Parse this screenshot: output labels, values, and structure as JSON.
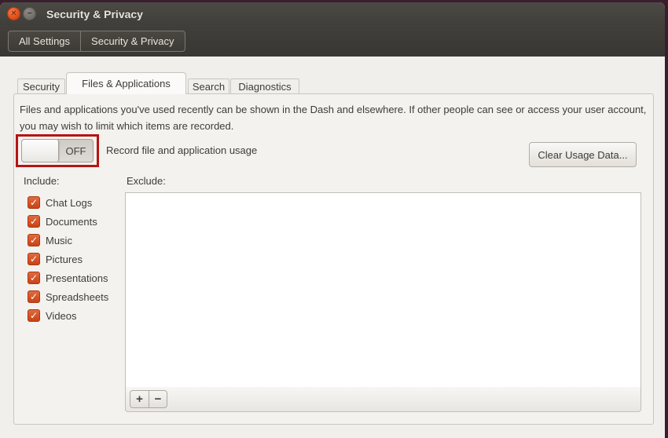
{
  "window": {
    "title": "Security & Privacy"
  },
  "titlebar": {
    "close_icon": "✕",
    "minimize_icon": "−"
  },
  "breadcrumb": {
    "items": [
      {
        "label": "All Settings"
      },
      {
        "label": "Security & Privacy"
      }
    ]
  },
  "tabs": [
    {
      "label": "Security",
      "active": false
    },
    {
      "label": "Files & Applications",
      "active": true
    },
    {
      "label": "Search",
      "active": false
    },
    {
      "label": "Diagnostics",
      "active": false
    }
  ],
  "files_applications": {
    "description": "Files and applications you've used recently can be shown in the Dash and elsewhere. If other people can see or access your user account, you may wish to limit which items are recorded.",
    "record_switch": {
      "state": "OFF",
      "label": "Record file and application usage",
      "annotated": true
    },
    "clear_button_label": "Clear Usage Data...",
    "include": {
      "label": "Include:",
      "items": [
        {
          "label": "Chat Logs",
          "checked": true
        },
        {
          "label": "Documents",
          "checked": true
        },
        {
          "label": "Music",
          "checked": true
        },
        {
          "label": "Pictures",
          "checked": true
        },
        {
          "label": "Presentations",
          "checked": true
        },
        {
          "label": "Spreadsheets",
          "checked": true
        },
        {
          "label": "Videos",
          "checked": true
        }
      ]
    },
    "exclude": {
      "label": "Exclude:",
      "entries": []
    },
    "toolbar": {
      "add_label": "+",
      "remove_label": "−"
    }
  },
  "icons": {
    "check": "✓"
  },
  "colors": {
    "accent_orange": "#dd4814",
    "annotation_red": "#b51414",
    "titlebar_dark": "#43413c",
    "desktop_edge": "#3a1e2e",
    "content_bg": "#f1efec"
  }
}
